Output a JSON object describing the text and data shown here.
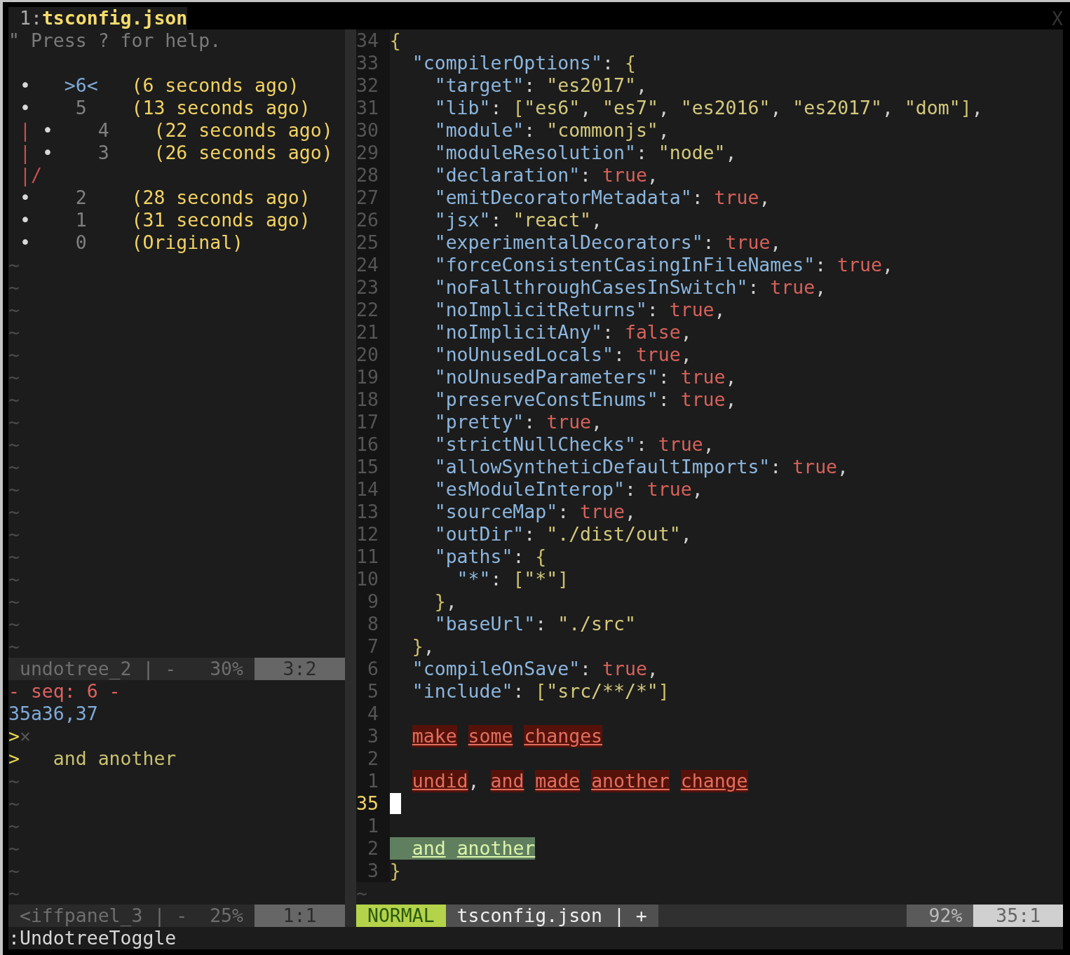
{
  "tabline": {
    "tabs": [
      {
        "number": "1:",
        "title": "tsconfig.json",
        "selected": true
      }
    ],
    "close": "X"
  },
  "undotree": {
    "help": "\" Press ? for help.",
    "rows": [
      {
        "kind": "entry",
        "graph": "•",
        "seq": ">6<",
        "time": "(6 seconds ago)",
        "current": true
      },
      {
        "kind": "entry",
        "graph": "•",
        "seq": "5",
        "time": "(13 seconds ago)",
        "current": false
      },
      {
        "kind": "entry",
        "rail": "|",
        "graph": "•",
        "seq": "4",
        "time": "(22 seconds ago)",
        "current": false
      },
      {
        "kind": "entry",
        "rail": "|",
        "graph": "•",
        "seq": "3",
        "time": "(26 seconds ago)",
        "current": false
      },
      {
        "kind": "merge",
        "text": "|/"
      },
      {
        "kind": "entry",
        "graph": "•",
        "seq": "2",
        "time": "(28 seconds ago)",
        "current": false
      },
      {
        "kind": "entry",
        "graph": "•",
        "seq": "1",
        "time": "(31 seconds ago)",
        "current": false
      },
      {
        "kind": "entry",
        "graph": "•",
        "seq": "0",
        "time": "(Original)",
        "current": false
      }
    ],
    "tildes": [
      "~",
      "~",
      "~",
      "~",
      "~",
      "~",
      "~",
      "~",
      "~",
      "~",
      "~",
      "~",
      "~",
      "~",
      "~",
      "~",
      "~",
      "~"
    ]
  },
  "undotree_status": {
    "name": "undotree_2 | -",
    "percent": "30%",
    "position": "3:2"
  },
  "diffpanel": {
    "lines": [
      {
        "kind": "header",
        "text": "- seq: 6 -"
      },
      {
        "kind": "range",
        "text": "35a36,37"
      },
      {
        "kind": "added_empty",
        "marker": ">",
        "text": "×"
      },
      {
        "kind": "added",
        "marker": ">",
        "text": "and another"
      }
    ],
    "tildes": [
      "~",
      "~",
      "~",
      "~",
      "~",
      "~"
    ]
  },
  "diffpanel_status": {
    "name": "<iffpanel_3 | -",
    "percent": "25%",
    "position": "1:1"
  },
  "editor": {
    "lines": [
      {
        "number": "34",
        "current": false,
        "added": false,
        "segments": [
          {
            "kind": "brace",
            "text": "{"
          }
        ]
      },
      {
        "number": "33",
        "current": false,
        "added": false,
        "segments": [
          {
            "kind": "key",
            "text": "  \"compilerOptions\""
          },
          {
            "kind": "punct",
            "text": ": "
          },
          {
            "kind": "brace",
            "text": "{"
          }
        ]
      },
      {
        "number": "32",
        "current": false,
        "added": false,
        "segments": [
          {
            "kind": "key",
            "text": "    \"target\""
          },
          {
            "kind": "punct",
            "text": ": "
          },
          {
            "kind": "string",
            "text": "\"es2017\""
          },
          {
            "kind": "punct",
            "text": ","
          }
        ]
      },
      {
        "number": "31",
        "current": false,
        "added": false,
        "segments": [
          {
            "kind": "key",
            "text": "    \"lib\""
          },
          {
            "kind": "punct",
            "text": ": "
          },
          {
            "kind": "brace",
            "text": "["
          },
          {
            "kind": "string",
            "text": "\"es6\""
          },
          {
            "kind": "punct",
            "text": ", "
          },
          {
            "kind": "string",
            "text": "\"es7\""
          },
          {
            "kind": "punct",
            "text": ", "
          },
          {
            "kind": "string",
            "text": "\"es2016\""
          },
          {
            "kind": "punct",
            "text": ", "
          },
          {
            "kind": "string",
            "text": "\"es2017\""
          },
          {
            "kind": "punct",
            "text": ", "
          },
          {
            "kind": "string",
            "text": "\"dom\""
          },
          {
            "kind": "brace",
            "text": "]"
          },
          {
            "kind": "punct",
            "text": ","
          }
        ]
      },
      {
        "number": "30",
        "current": false,
        "added": false,
        "segments": [
          {
            "kind": "key",
            "text": "    \"module\""
          },
          {
            "kind": "punct",
            "text": ": "
          },
          {
            "kind": "string",
            "text": "\"commonjs\""
          },
          {
            "kind": "punct",
            "text": ","
          }
        ]
      },
      {
        "number": "29",
        "current": false,
        "added": false,
        "segments": [
          {
            "kind": "key",
            "text": "    \"moduleResolution\""
          },
          {
            "kind": "punct",
            "text": ": "
          },
          {
            "kind": "string",
            "text": "\"node\""
          },
          {
            "kind": "punct",
            "text": ","
          }
        ]
      },
      {
        "number": "28",
        "current": false,
        "added": false,
        "segments": [
          {
            "kind": "key",
            "text": "    \"declaration\""
          },
          {
            "kind": "punct",
            "text": ": "
          },
          {
            "kind": "bool",
            "text": "true"
          },
          {
            "kind": "punct",
            "text": ","
          }
        ]
      },
      {
        "number": "27",
        "current": false,
        "added": false,
        "segments": [
          {
            "kind": "key",
            "text": "    \"emitDecoratorMetadata\""
          },
          {
            "kind": "punct",
            "text": ": "
          },
          {
            "kind": "bool",
            "text": "true"
          },
          {
            "kind": "punct",
            "text": ","
          }
        ]
      },
      {
        "number": "26",
        "current": false,
        "added": false,
        "segments": [
          {
            "kind": "key",
            "text": "    \"jsx\""
          },
          {
            "kind": "punct",
            "text": ": "
          },
          {
            "kind": "string",
            "text": "\"react\""
          },
          {
            "kind": "punct",
            "text": ","
          }
        ]
      },
      {
        "number": "25",
        "current": false,
        "added": false,
        "segments": [
          {
            "kind": "key",
            "text": "    \"experimentalDecorators\""
          },
          {
            "kind": "punct",
            "text": ": "
          },
          {
            "kind": "bool",
            "text": "true"
          },
          {
            "kind": "punct",
            "text": ","
          }
        ]
      },
      {
        "number": "24",
        "current": false,
        "added": false,
        "segments": [
          {
            "kind": "key",
            "text": "    \"forceConsistentCasingInFileNames\""
          },
          {
            "kind": "punct",
            "text": ": "
          },
          {
            "kind": "bool",
            "text": "true"
          },
          {
            "kind": "punct",
            "text": ","
          }
        ]
      },
      {
        "number": "23",
        "current": false,
        "added": false,
        "segments": [
          {
            "kind": "key",
            "text": "    \"noFallthroughCasesInSwitch\""
          },
          {
            "kind": "punct",
            "text": ": "
          },
          {
            "kind": "bool",
            "text": "true"
          },
          {
            "kind": "punct",
            "text": ","
          }
        ]
      },
      {
        "number": "22",
        "current": false,
        "added": false,
        "segments": [
          {
            "kind": "key",
            "text": "    \"noImplicitReturns\""
          },
          {
            "kind": "punct",
            "text": ": "
          },
          {
            "kind": "bool",
            "text": "true"
          },
          {
            "kind": "punct",
            "text": ","
          }
        ]
      },
      {
        "number": "21",
        "current": false,
        "added": false,
        "segments": [
          {
            "kind": "key",
            "text": "    \"noImplicitAny\""
          },
          {
            "kind": "punct",
            "text": ": "
          },
          {
            "kind": "bool",
            "text": "false"
          },
          {
            "kind": "punct",
            "text": ","
          }
        ]
      },
      {
        "number": "20",
        "current": false,
        "added": false,
        "segments": [
          {
            "kind": "key",
            "text": "    \"noUnusedLocals\""
          },
          {
            "kind": "punct",
            "text": ": "
          },
          {
            "kind": "bool",
            "text": "true"
          },
          {
            "kind": "punct",
            "text": ","
          }
        ]
      },
      {
        "number": "19",
        "current": false,
        "added": false,
        "segments": [
          {
            "kind": "key",
            "text": "    \"noUnusedParameters\""
          },
          {
            "kind": "punct",
            "text": ": "
          },
          {
            "kind": "bool",
            "text": "true"
          },
          {
            "kind": "punct",
            "text": ","
          }
        ]
      },
      {
        "number": "18",
        "current": false,
        "added": false,
        "segments": [
          {
            "kind": "key",
            "text": "    \"preserveConstEnums\""
          },
          {
            "kind": "punct",
            "text": ": "
          },
          {
            "kind": "bool",
            "text": "true"
          },
          {
            "kind": "punct",
            "text": ","
          }
        ]
      },
      {
        "number": "17",
        "current": false,
        "added": false,
        "segments": [
          {
            "kind": "key",
            "text": "    \"pretty\""
          },
          {
            "kind": "punct",
            "text": ": "
          },
          {
            "kind": "bool",
            "text": "true"
          },
          {
            "kind": "punct",
            "text": ","
          }
        ]
      },
      {
        "number": "16",
        "current": false,
        "added": false,
        "segments": [
          {
            "kind": "key",
            "text": "    \"strictNullChecks\""
          },
          {
            "kind": "punct",
            "text": ": "
          },
          {
            "kind": "bool",
            "text": "true"
          },
          {
            "kind": "punct",
            "text": ","
          }
        ]
      },
      {
        "number": "15",
        "current": false,
        "added": false,
        "segments": [
          {
            "kind": "key",
            "text": "    \"allowSyntheticDefaultImports\""
          },
          {
            "kind": "punct",
            "text": ": "
          },
          {
            "kind": "bool",
            "text": "true"
          },
          {
            "kind": "punct",
            "text": ","
          }
        ]
      },
      {
        "number": "14",
        "current": false,
        "added": false,
        "segments": [
          {
            "kind": "key",
            "text": "    \"esModuleInterop\""
          },
          {
            "kind": "punct",
            "text": ": "
          },
          {
            "kind": "bool",
            "text": "true"
          },
          {
            "kind": "punct",
            "text": ","
          }
        ]
      },
      {
        "number": "13",
        "current": false,
        "added": false,
        "segments": [
          {
            "kind": "key",
            "text": "    \"sourceMap\""
          },
          {
            "kind": "punct",
            "text": ": "
          },
          {
            "kind": "bool",
            "text": "true"
          },
          {
            "kind": "punct",
            "text": ","
          }
        ]
      },
      {
        "number": "12",
        "current": false,
        "added": false,
        "segments": [
          {
            "kind": "key",
            "text": "    \"outDir\""
          },
          {
            "kind": "punct",
            "text": ": "
          },
          {
            "kind": "string",
            "text": "\"./dist/out\""
          },
          {
            "kind": "punct",
            "text": ","
          }
        ]
      },
      {
        "number": "11",
        "current": false,
        "added": false,
        "segments": [
          {
            "kind": "key",
            "text": "    \"paths\""
          },
          {
            "kind": "punct",
            "text": ": "
          },
          {
            "kind": "brace",
            "text": "{"
          }
        ]
      },
      {
        "number": "10",
        "current": false,
        "added": false,
        "segments": [
          {
            "kind": "key",
            "text": "      \"*\""
          },
          {
            "kind": "punct",
            "text": ": "
          },
          {
            "kind": "brace",
            "text": "["
          },
          {
            "kind": "string",
            "text": "\"*\""
          },
          {
            "kind": "brace",
            "text": "]"
          }
        ]
      },
      {
        "number": "9",
        "current": false,
        "added": false,
        "segments": [
          {
            "kind": "brace",
            "text": "    }"
          },
          {
            "kind": "punct",
            "text": ","
          }
        ]
      },
      {
        "number": "8",
        "current": false,
        "added": false,
        "segments": [
          {
            "kind": "key",
            "text": "    \"baseUrl\""
          },
          {
            "kind": "punct",
            "text": ": "
          },
          {
            "kind": "string",
            "text": "\"./src\""
          }
        ]
      },
      {
        "number": "7",
        "current": false,
        "added": false,
        "segments": [
          {
            "kind": "brace",
            "text": "  }"
          },
          {
            "kind": "punct",
            "text": ","
          }
        ]
      },
      {
        "number": "6",
        "current": false,
        "added": false,
        "segments": [
          {
            "kind": "key",
            "text": "  \"compileOnSave\""
          },
          {
            "kind": "punct",
            "text": ": "
          },
          {
            "kind": "bool",
            "text": "true"
          },
          {
            "kind": "punct",
            "text": ","
          }
        ]
      },
      {
        "number": "5",
        "current": false,
        "added": false,
        "segments": [
          {
            "kind": "key",
            "text": "  \"include\""
          },
          {
            "kind": "punct",
            "text": ": "
          },
          {
            "kind": "brace",
            "text": "["
          },
          {
            "kind": "string",
            "text": "\"src/**/*\""
          },
          {
            "kind": "brace",
            "text": "]"
          }
        ]
      },
      {
        "number": "4",
        "current": false,
        "added": false
      },
      {
        "number": "3",
        "current": false,
        "added": false,
        "segments": [
          {
            "kind": "deleted",
            "text": "  make"
          },
          {
            "kind": "deleted",
            "text": " some"
          },
          {
            "kind": "deleted",
            "text": " changes"
          }
        ]
      },
      {
        "number": "2",
        "current": false,
        "added": false
      },
      {
        "number": "1",
        "current": false,
        "added": false,
        "segments": [
          {
            "kind": "deleted",
            "text": "  undid"
          },
          {
            "kind": "punct",
            "text": ","
          },
          {
            "kind": "deleted",
            "text": " and"
          },
          {
            "kind": "deleted",
            "text": " made"
          },
          {
            "kind": "deleted",
            "text": " another"
          },
          {
            "kind": "deleted",
            "text": " change"
          }
        ]
      },
      {
        "number": "35",
        "current": true,
        "added": false
      },
      {
        "number": "1",
        "current": false,
        "added": false
      },
      {
        "number": "2",
        "current": false,
        "added": true,
        "segments": [
          {
            "kind": "inserted",
            "text": "  and"
          },
          {
            "kind": "inserted",
            "text": " another"
          }
        ]
      },
      {
        "number": "3",
        "current": false,
        "added": false,
        "segments": [
          {
            "kind": "brace",
            "text": "}"
          }
        ]
      }
    ],
    "tildes": [
      "~"
    ]
  },
  "statusline": {
    "mode": "NORMAL",
    "file": "tsconfig.json | +",
    "percent": "92%",
    "position": "35:1"
  },
  "command_line": ":UndotreeToggle"
}
